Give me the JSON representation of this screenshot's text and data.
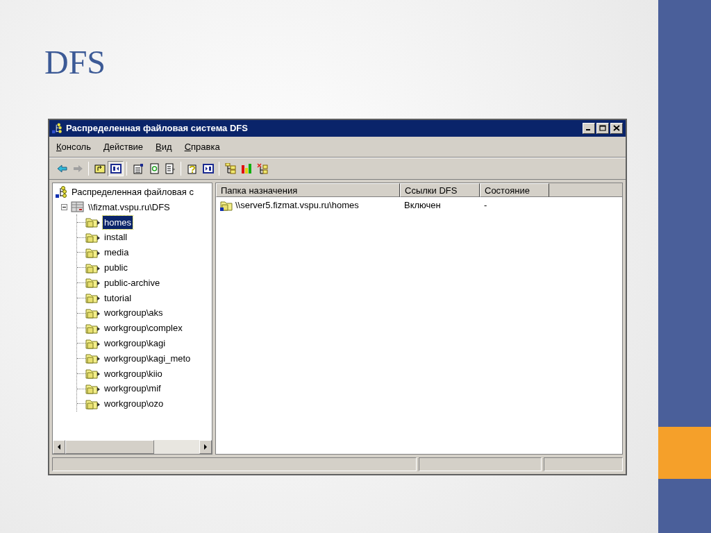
{
  "slide": {
    "title": "DFS"
  },
  "window": {
    "title": "Распределенная файловая система DFS"
  },
  "menu": [
    "Консоль",
    "Действие",
    "Вид",
    "Справка"
  ],
  "toolbar": [
    {
      "pressed": false
    },
    {
      "pressed": false
    },
    {
      "pressed": false
    },
    {
      "pressed": true
    },
    {
      "pressed": false
    },
    {
      "pressed": false
    },
    {
      "pressed": false
    },
    {
      "pressed": false
    },
    {
      "pressed": false
    },
    {
      "pressed": false
    },
    {
      "pressed": false
    },
    {
      "pressed": false
    }
  ],
  "tree": [
    {
      "label": "Распределенная файловая с",
      "selected": false,
      "children": [
        {
          "label": "\\\\fizmat.vspu.ru\\DFS",
          "selected": false,
          "expanded": true,
          "children": [
            {
              "label": "homes",
              "selected": true
            },
            {
              "label": "install",
              "selected": false
            },
            {
              "label": "media",
              "selected": false
            },
            {
              "label": "public",
              "selected": false
            },
            {
              "label": "public-archive",
              "selected": false
            },
            {
              "label": "tutorial",
              "selected": false
            },
            {
              "label": "workgroup\\aks",
              "selected": false
            },
            {
              "label": "workgroup\\complex",
              "selected": false
            },
            {
              "label": "workgroup\\kagi",
              "selected": false
            },
            {
              "label": "workgroup\\kagi_meto",
              "selected": false
            },
            {
              "label": "workgroup\\kiio",
              "selected": false
            },
            {
              "label": "workgroup\\mif",
              "selected": false
            },
            {
              "label": "workgroup\\ozo",
              "selected": false
            }
          ]
        }
      ]
    }
  ],
  "table": {
    "columns": [
      "Папка назначения",
      "Ссылки DFS",
      "Состояние"
    ],
    "rows": [
      {
        "cells": [
          "\\\\server5.fizmat.vspu.ru\\homes",
          "Включен",
          "-"
        ]
      }
    ]
  }
}
